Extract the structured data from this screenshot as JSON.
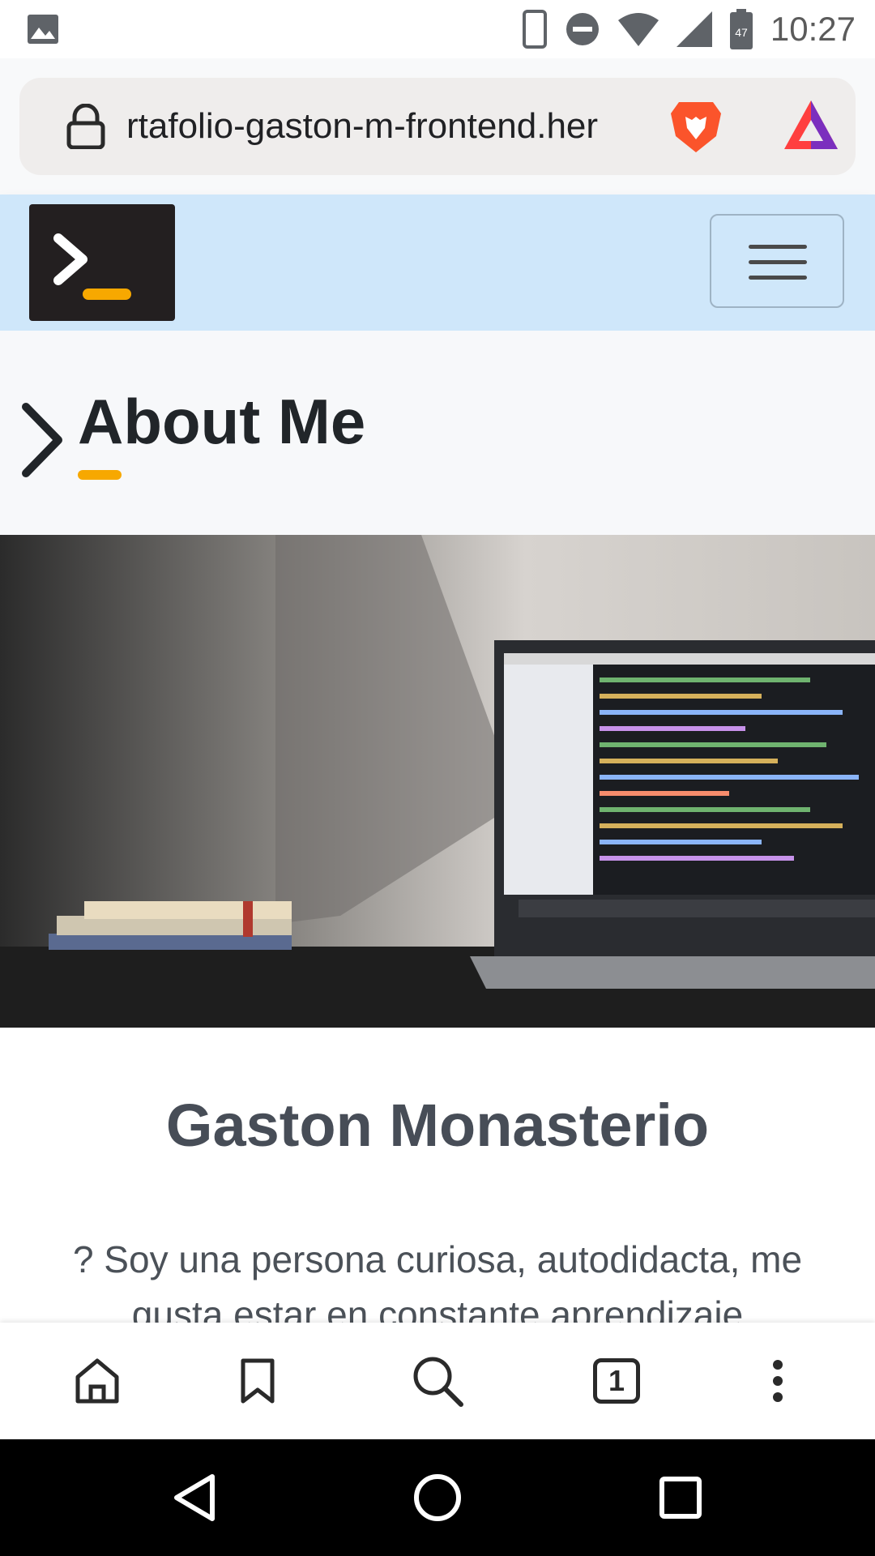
{
  "status_bar": {
    "time": "10:27",
    "battery_level": "47"
  },
  "browser": {
    "url": "rtafolio-gaston-m-frontend.her",
    "tab_count": "1"
  },
  "navbar": {
    "logo_icon": "terminal-prompt-icon",
    "menu_icon": "hamburger-menu-icon"
  },
  "section": {
    "title": "About Me"
  },
  "hero_image": {
    "description_icon": "laptop-desk-photo"
  },
  "profile": {
    "name": "Gaston Monasterio",
    "bio": "? Soy una persona curiosa, autodidacta, me gusta estar en constante aprendizaje"
  },
  "bottom_nav": [
    "home-icon",
    "bookmark-icon",
    "search-icon",
    "tabs-icon",
    "more-menu-icon"
  ],
  "colors": {
    "accent": "#f7a800",
    "navbar_bg": "#cfe7fa",
    "logo_bg": "#231f20"
  }
}
